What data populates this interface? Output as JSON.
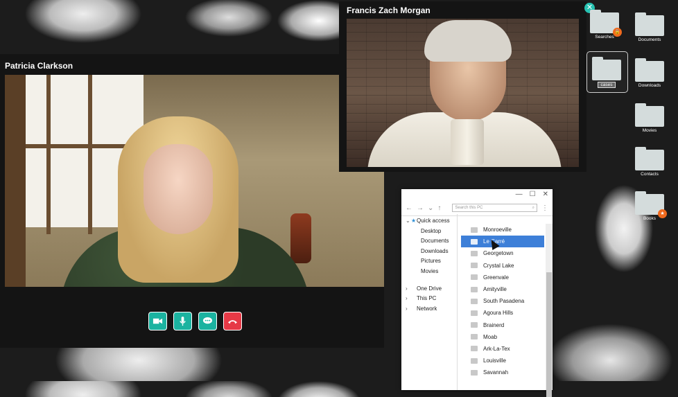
{
  "calls": {
    "patricia": {
      "name": "Patricia Clarkson"
    },
    "francis": {
      "name": "Francis Zach Morgan",
      "close_icon": "close-icon"
    }
  },
  "call_controls": [
    {
      "name": "video-button",
      "icon": "video-camera-icon"
    },
    {
      "name": "mic-button",
      "icon": "microphone-icon"
    },
    {
      "name": "chat-button",
      "icon": "chat-bubble-icon"
    },
    {
      "name": "end-call-button",
      "icon": "hang-up-icon"
    }
  ],
  "colors": {
    "accent": "#1bb3a0",
    "end_call": "#e63946",
    "selection": "#3d7fd8",
    "badge": "#f06a1e"
  },
  "explorer": {
    "search_placeholder": "Search this PC",
    "sidebar": [
      "Quick access",
      "Desktop",
      "Documents",
      "Downloads",
      "Pictures",
      "Movies",
      "One Drive",
      "This PC",
      "Network"
    ],
    "folders": [
      "Monroeville",
      "Le Carré",
      "Georgetown",
      "Crystal Lake",
      "Greenvale",
      "Amityville",
      "South Pasadena",
      "Agoura Hills",
      "Brainerd",
      "Moab",
      "Ark-La-Tex",
      "Louisville",
      "Savannah"
    ],
    "selected": "Le Carré"
  },
  "desktop": {
    "icons": [
      "Searches",
      "Documents",
      "cases",
      "Downloads",
      "Movies",
      "Contacts",
      "Books"
    ]
  }
}
